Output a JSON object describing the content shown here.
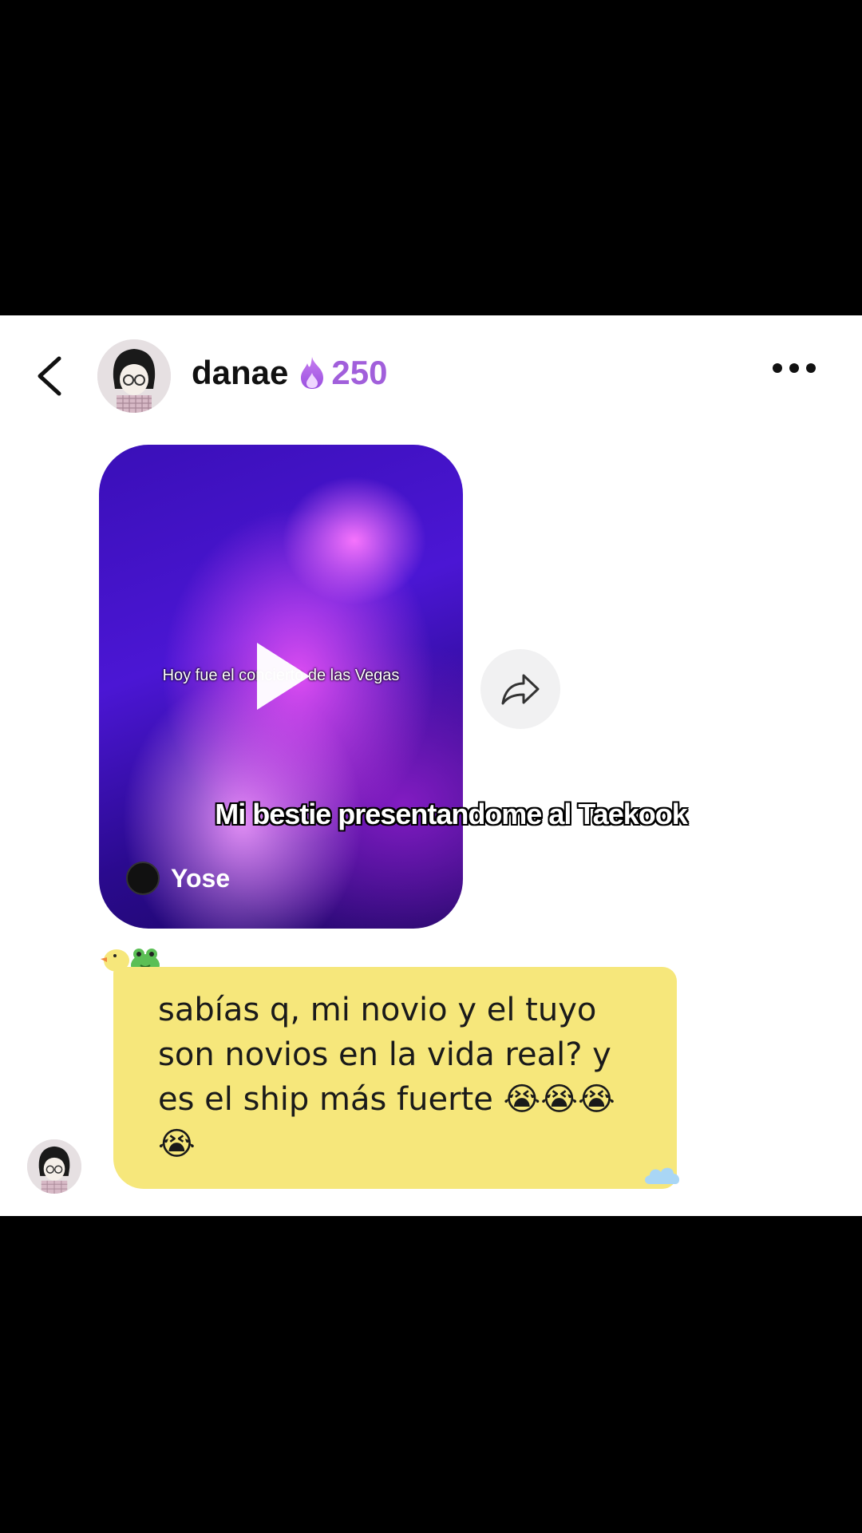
{
  "header": {
    "username": "danae",
    "streak_icon": "flame-icon",
    "streak_count": "250",
    "accent": "#a15fdb"
  },
  "video": {
    "caption": "Hoy fue el concierto de las Vegas",
    "author": "Yose"
  },
  "overlay_caption": "Mi bestie presentandome al Taekook",
  "message": {
    "text": "sabías q, mi novio y el tuyo son novios en la vida real? y es el ship más fuerte 😭😭😭😭",
    "bubble_color": "#f6e77b"
  }
}
